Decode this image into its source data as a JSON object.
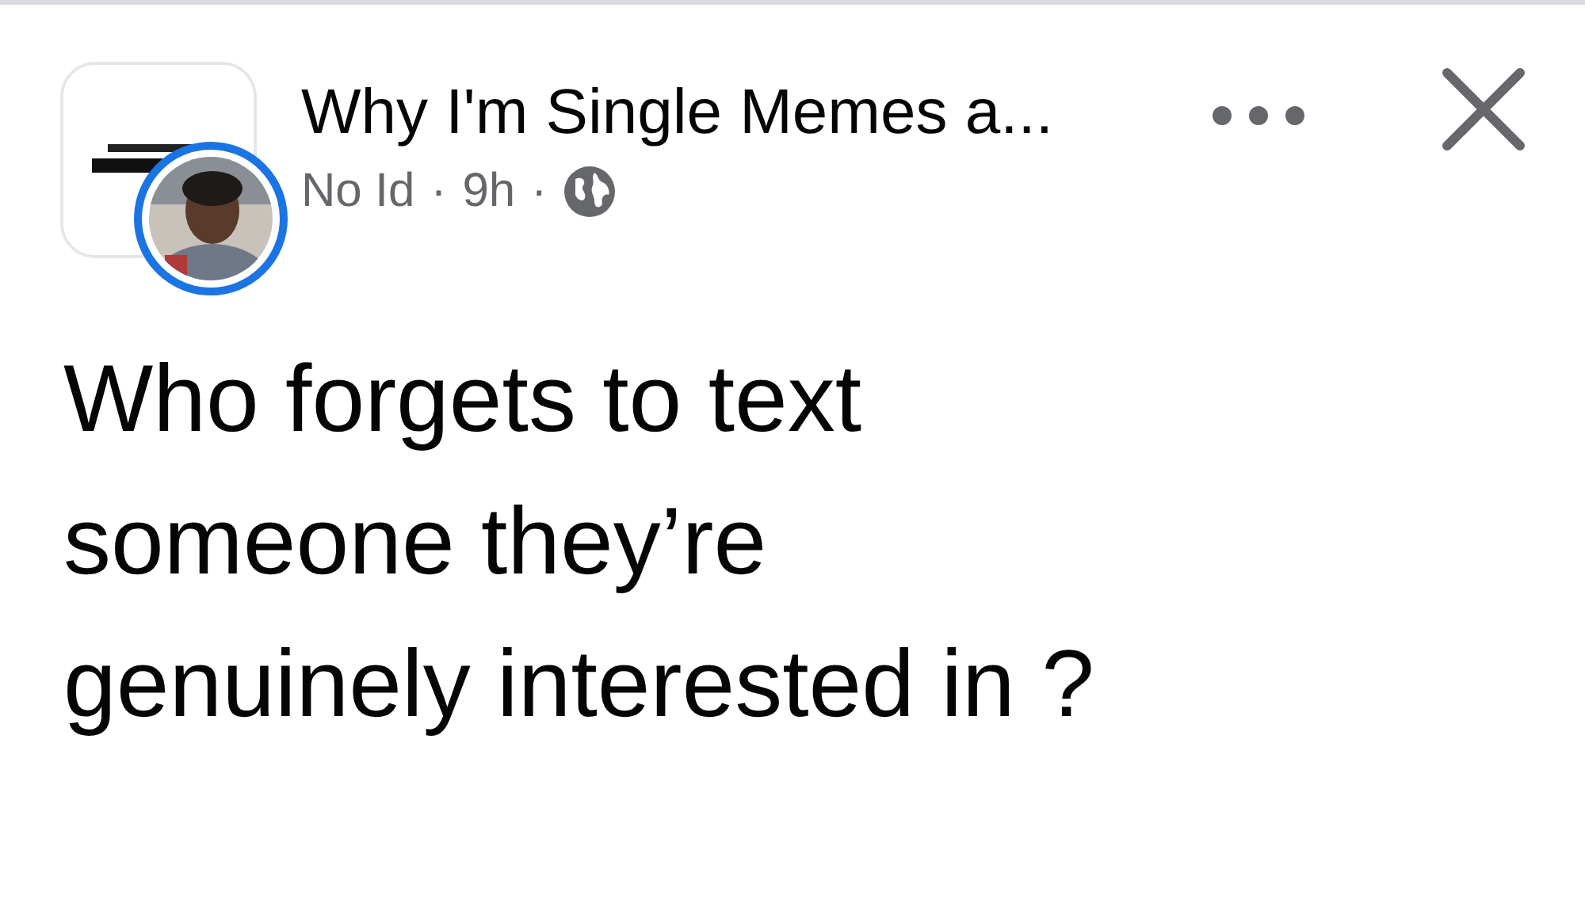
{
  "post": {
    "page_name": "Why I'm Single Memes a...",
    "author": "No Id",
    "separator_1": "·",
    "time": "9h",
    "separator_2": "·",
    "text_lines": [
      "Who forgets to text",
      "someone they’re",
      "genuinely interested in ?"
    ]
  }
}
